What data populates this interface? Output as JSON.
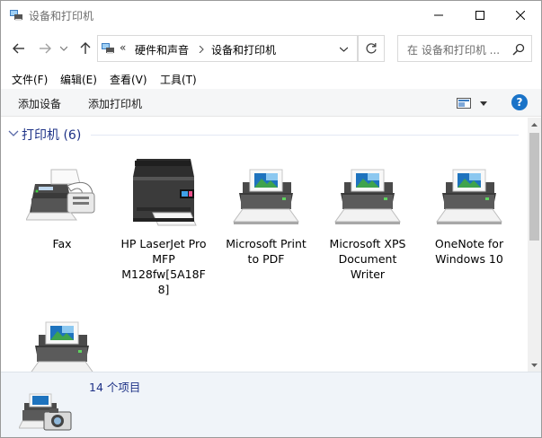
{
  "window": {
    "title": "设备和打印机"
  },
  "nav": {
    "breadcrumb_overflow": "«",
    "breadcrumb": [
      "硬件和声音",
      "设备和打印机"
    ],
    "search_placeholder": "在 设备和打印机 ..."
  },
  "menu": [
    "文件(F)",
    "编辑(E)",
    "查看(V)",
    "工具(T)"
  ],
  "commands": {
    "add_device": "添加设备",
    "add_printer": "添加打印机",
    "help": "?"
  },
  "group": {
    "title": "打印机 (6)"
  },
  "devices": [
    {
      "label": "Fax",
      "icon": "fax-icon"
    },
    {
      "label": "HP LaserJet Pro MFP M128fw[5A18F8]",
      "icon": "laserjet-mfp-icon"
    },
    {
      "label": "Microsoft Print to PDF",
      "icon": "printer-icon"
    },
    {
      "label": "Microsoft XPS Document Writer",
      "icon": "printer-icon"
    },
    {
      "label": "OneNote for Windows 10",
      "icon": "printer-icon"
    },
    {
      "label": "",
      "icon": "printer-icon"
    }
  ],
  "details": {
    "count_text": "14 个项目",
    "icon": "devices-camera-printer-icon"
  },
  "colors": {
    "group_title": "#1e3287",
    "command_bar": "#f5f6f7",
    "details_bg": "#f0f4f9",
    "help_blue": "#1a73c8"
  }
}
